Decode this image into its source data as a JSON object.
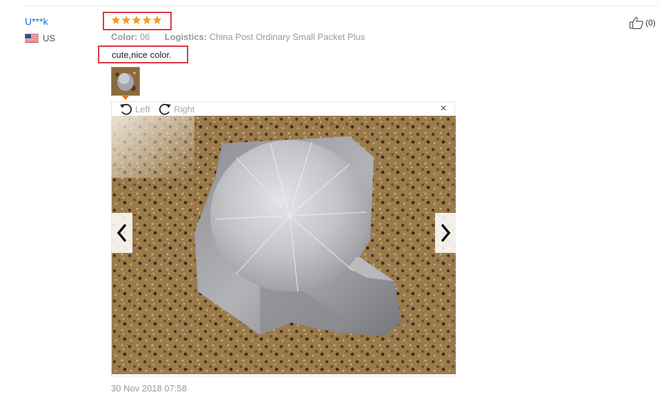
{
  "review": {
    "user_name": "U***k",
    "country": "US",
    "rating": 5,
    "attributes": {
      "color_label": "Color:",
      "color_value": "06",
      "logistics_label": "Logistics:",
      "logistics_value": "China Post Ordinary Small Packet Plus"
    },
    "text": "cute,nice color.",
    "date": "30 Nov 2018 07:58",
    "helpful_count": "(0)"
  },
  "viewer": {
    "rotate_left_label": "Left",
    "rotate_right_label": "Right",
    "close_symbol": "×"
  },
  "icons": {
    "star": "star-icon",
    "flag": "us-flag-icon",
    "like": "thumbs-up-icon",
    "rotate_left": "rotate-left-icon",
    "rotate_right": "rotate-right-icon",
    "prev": "chevron-left-icon",
    "next": "chevron-right-icon"
  },
  "colors": {
    "highlight_border": "#d9383d",
    "star": "#f59a23",
    "user_link": "#1b6cc4",
    "thumb_pointer": "#ff6a00"
  }
}
